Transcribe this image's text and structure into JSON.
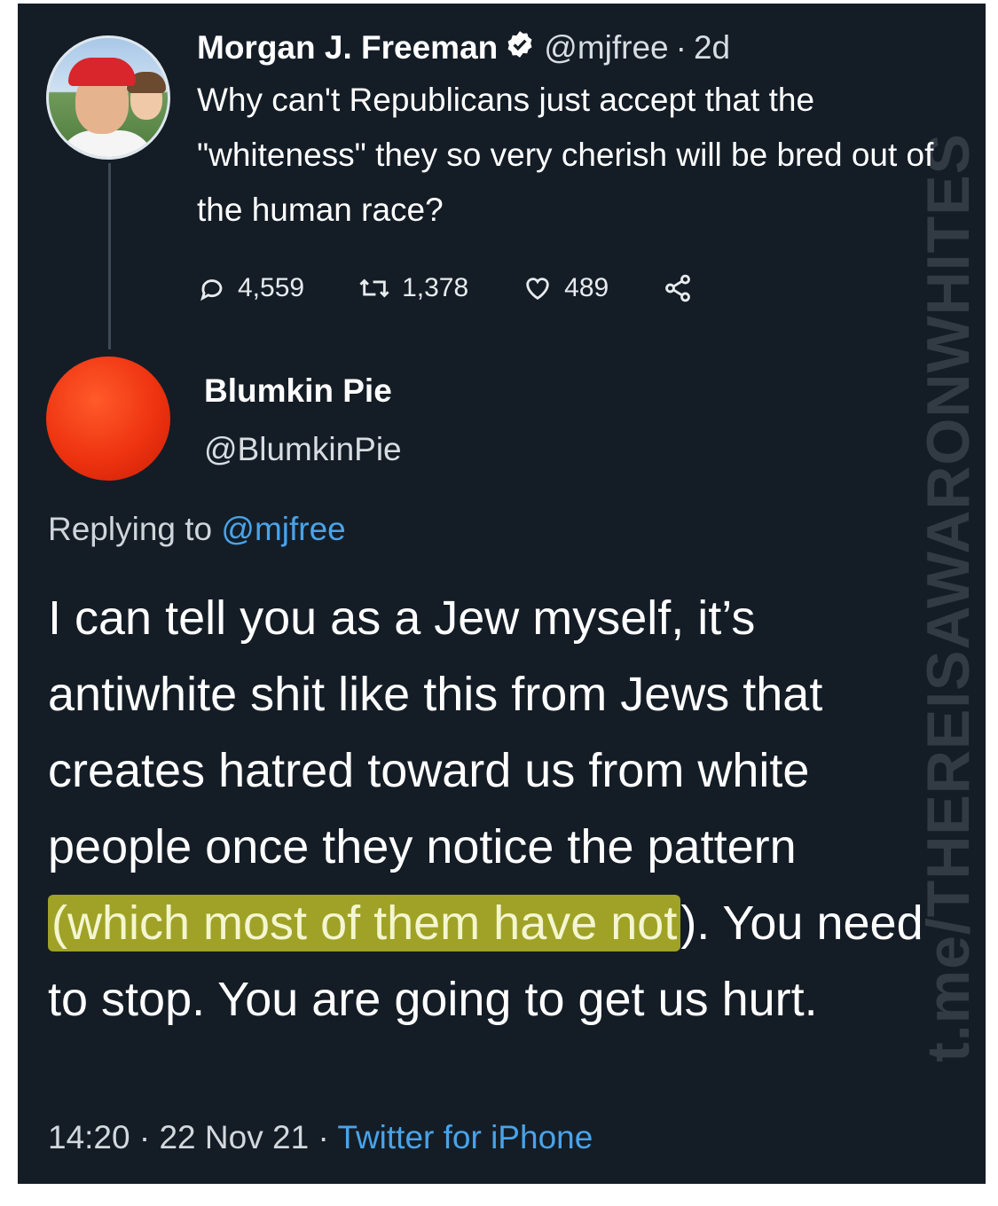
{
  "tweet": {
    "author_name": "Morgan J. Freeman",
    "author_handle": "@mjfree",
    "separator": "·",
    "time_ago": "2d",
    "text": "Why can't Republicans just accept that the \"whiteness\" they so very cherish will be bred out of the human race?",
    "replies": "4,559",
    "retweets": "1,378",
    "likes": "489",
    "icons": [
      "verified-badge-icon",
      "reply-icon",
      "retweet-icon",
      "like-icon",
      "share-icon"
    ]
  },
  "reply": {
    "author_name": "Blumkin Pie",
    "author_handle": "@BlumkinPie",
    "replying_label": "Replying to",
    "replying_to": "@mjfree",
    "text_before": "I can tell you as a Jew myself, it’s antiwhite shit like this from Jews that creates hatred toward us from white people once they notice the pattern ",
    "text_highlighted": "(which most of them have not",
    "text_after": "). You need to stop. You are going to get us hurt.",
    "time": "14:20",
    "separator": "·",
    "date": "22 Nov 21",
    "source": "Twitter for iPhone",
    "highlight_color": "#c6c828"
  },
  "watermark": "t.me/THEREISAWARONWHITES"
}
